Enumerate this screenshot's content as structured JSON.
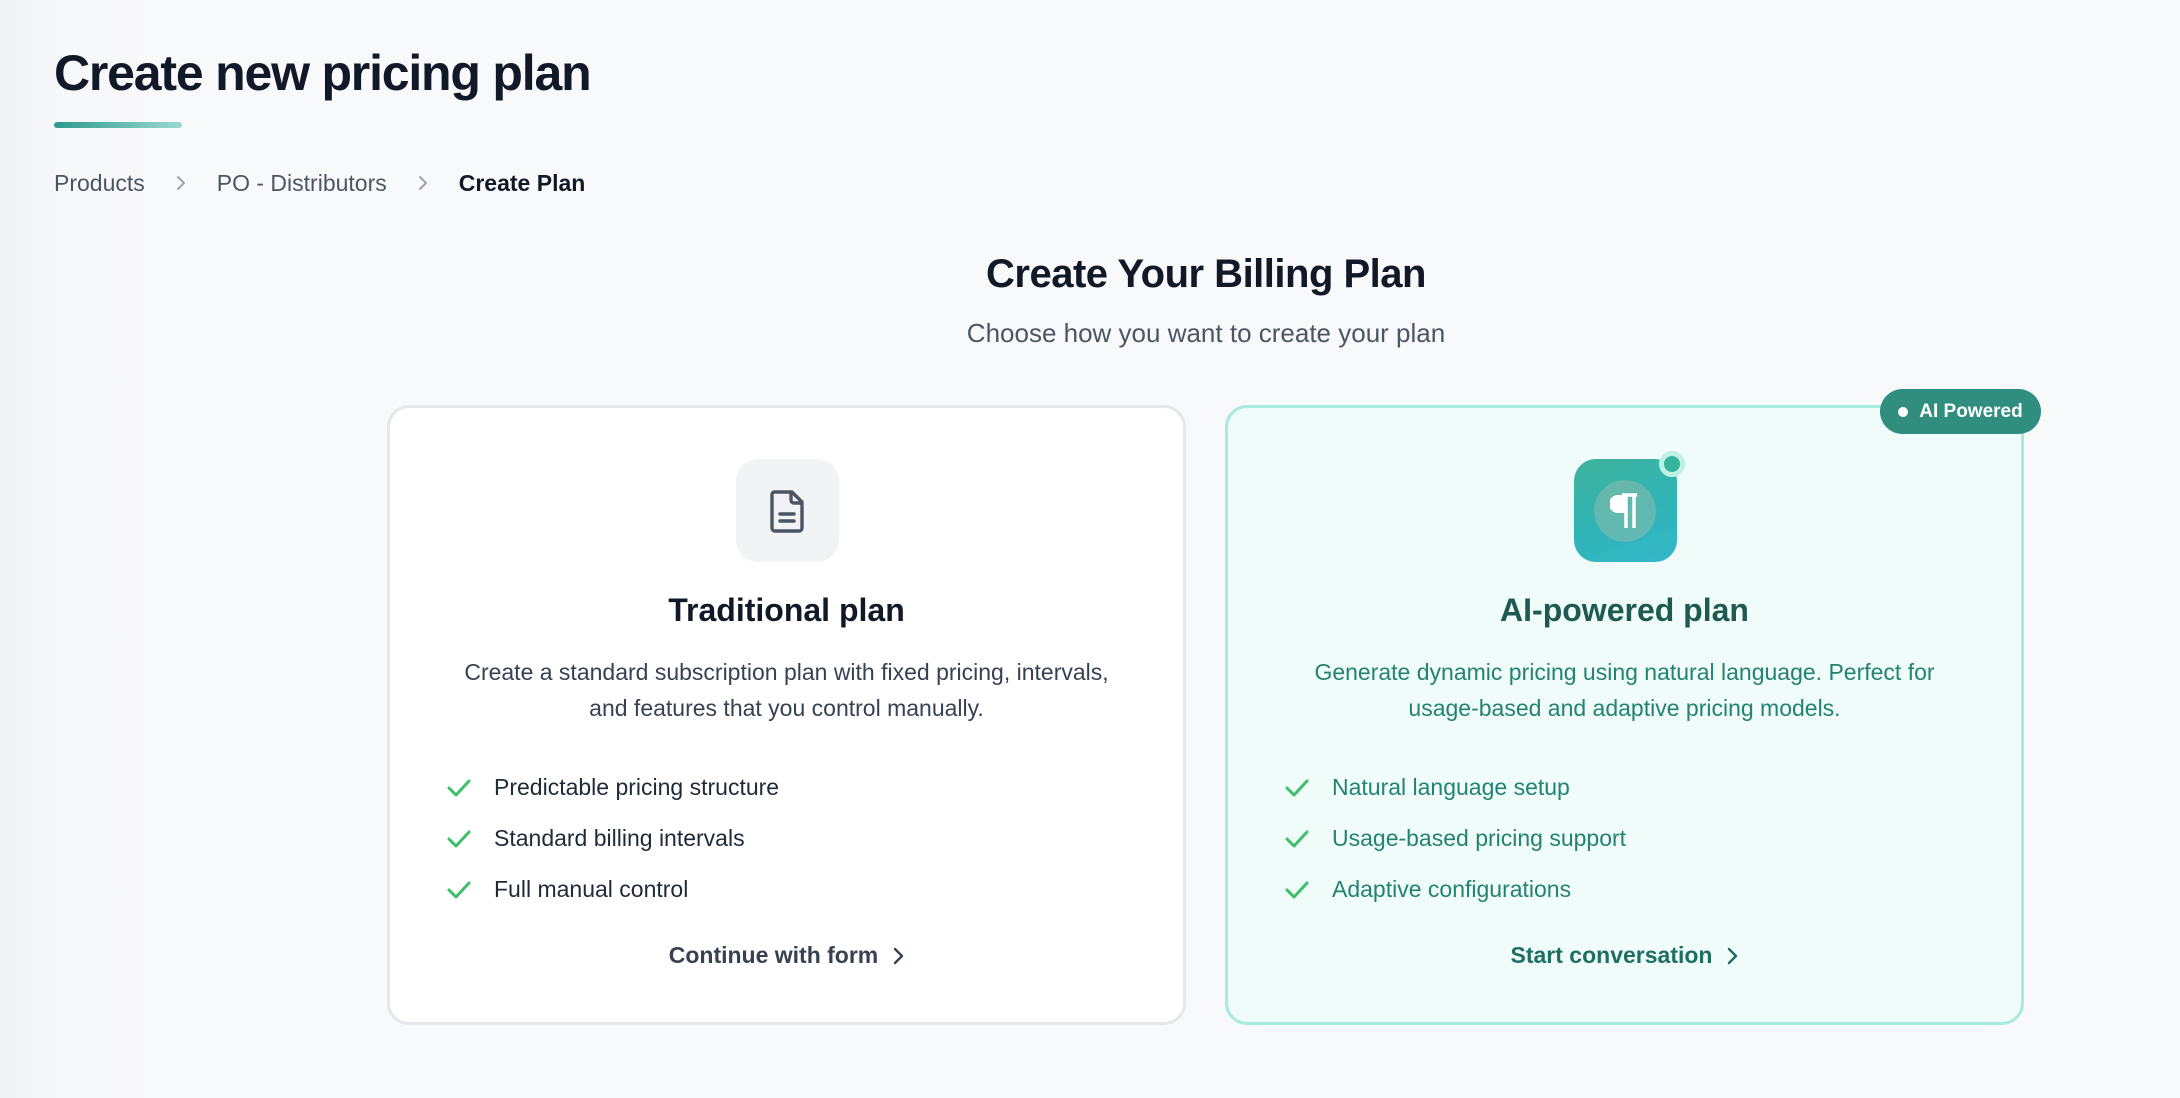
{
  "page": {
    "title": "Create new pricing plan"
  },
  "breadcrumb": {
    "items": [
      "Products",
      "PO - Distributors",
      "Create Plan"
    ]
  },
  "main": {
    "heading": "Create Your Billing Plan",
    "subheading": "Choose how you want to create your plan"
  },
  "traditional": {
    "icon": "document-icon",
    "title": "Traditional plan",
    "description": "Create a standard subscription plan with fixed pricing, intervals, and features that you control manually.",
    "features": [
      "Predictable pricing structure",
      "Standard billing intervals",
      "Full manual control"
    ],
    "action_label": "Continue with form"
  },
  "ai": {
    "badge": "AI Powered",
    "icon": "pilcrow-icon",
    "title": "AI-powered plan",
    "description": "Generate dynamic pricing using natural language. Perfect for usage-based and adaptive pricing models.",
    "features": [
      "Natural language setup",
      "Usage-based pricing support",
      "Adaptive configurations"
    ],
    "action_label": "Start conversation"
  },
  "colors": {
    "accent": "#2f8e7e",
    "check": "#3fbf6a",
    "ai_card_bg": "#effcf9",
    "ai_card_border": "#a8eadb"
  }
}
